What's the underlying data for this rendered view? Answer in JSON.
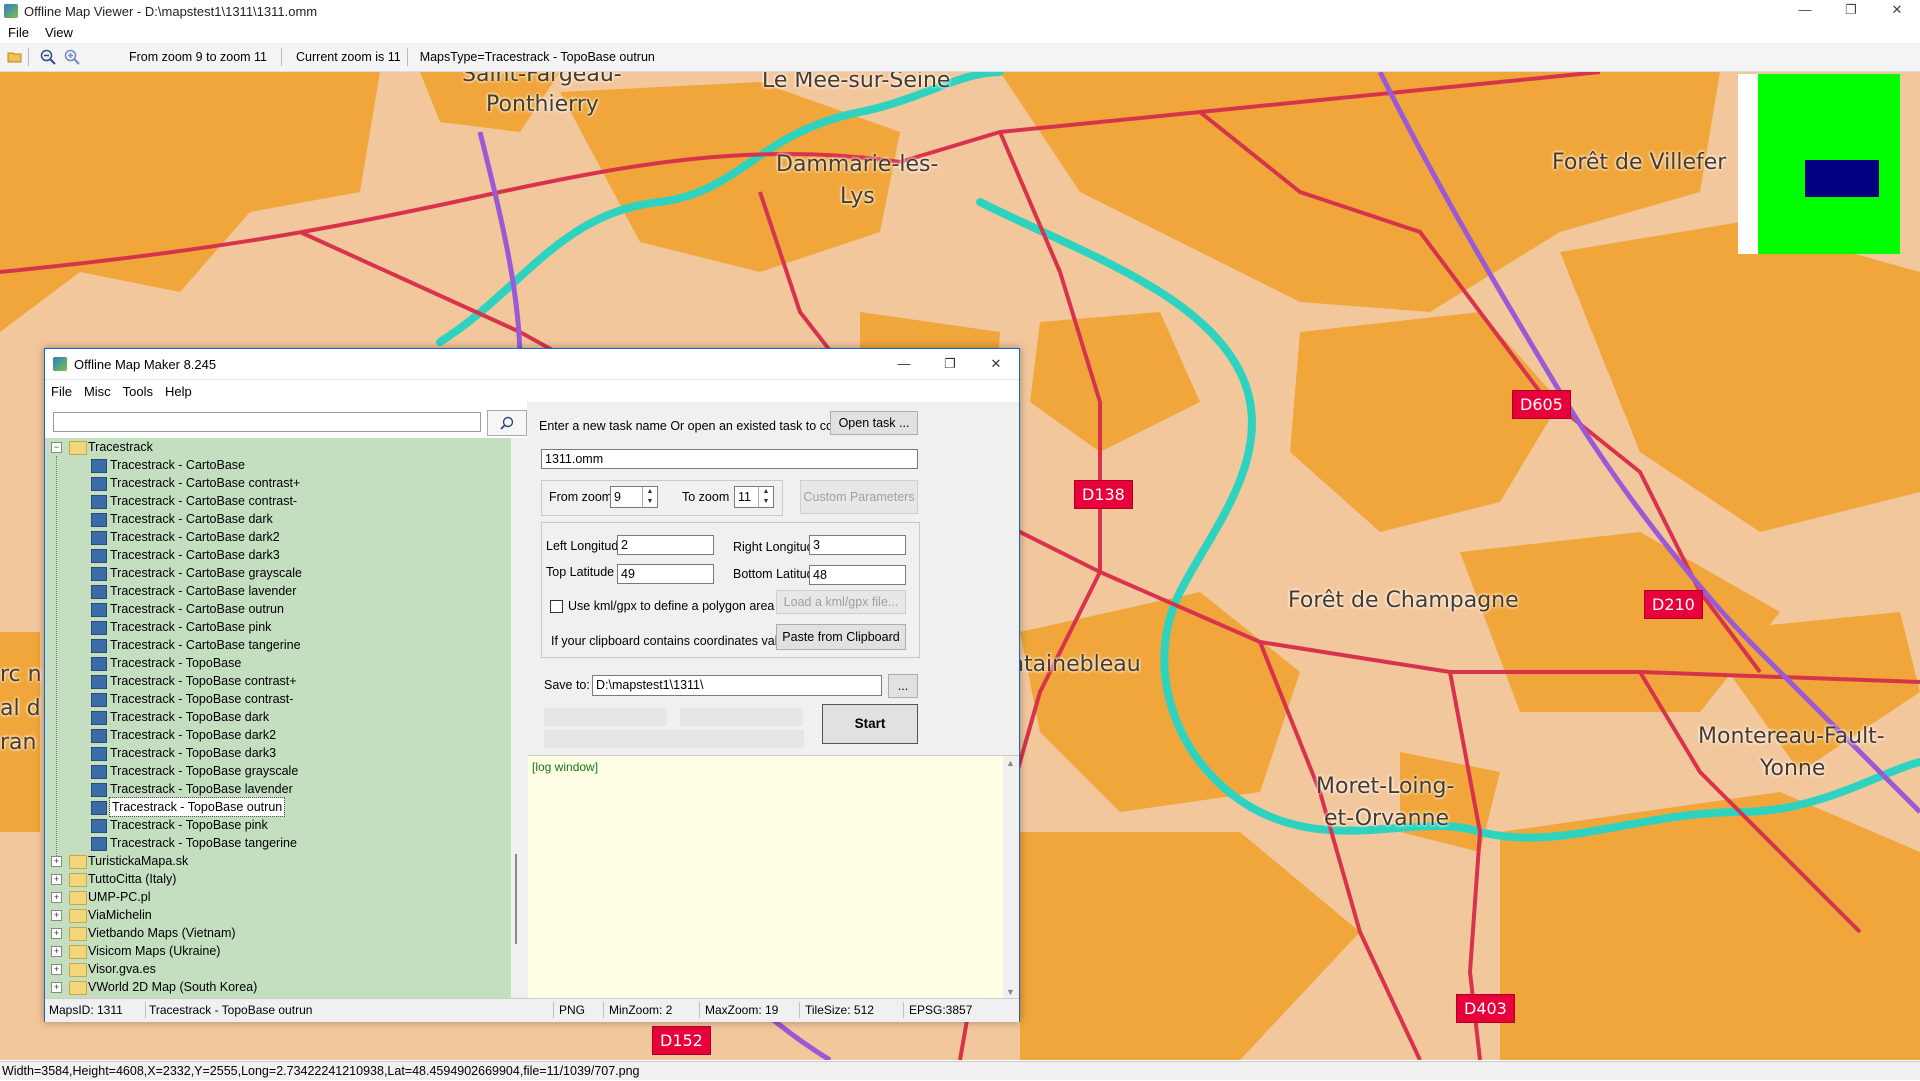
{
  "window": {
    "title": "Offline Map Viewer - D:\\mapstest1\\1311\\1311.omm",
    "controls": [
      "—",
      "❐",
      "✕"
    ]
  },
  "menu": [
    "File",
    "View"
  ],
  "toolbar": {
    "zoom_range": "From zoom 9 to zoom 11",
    "current_zoom": "Current zoom is 11",
    "maps_type": "MapsType=Tracestrack - TopoBase outrun"
  },
  "map": {
    "labels": [
      "Saint-Fargeau-",
      "Ponthierry",
      "Le Mee-sur-Seine",
      "Dammarie-les-",
      "Lys",
      "Forêt de Villefer",
      "Forêt de Champagne",
      "ntainebleau",
      "Moret-Loing-",
      "et-Orvanne",
      "Montereau-Fault-",
      "Yonne",
      "rc n",
      "al d",
      "ran"
    ],
    "road_badges": [
      "D605",
      "D138",
      "D210",
      "D403",
      "D152"
    ],
    "colors": {
      "land": "#f3c79c",
      "forest": "#f0a63a",
      "water": "#2ed3c0",
      "road_red": "#d8334d",
      "road_purple": "#9a5ad6"
    }
  },
  "minimap": {
    "bg": "#00ff00",
    "viewport": "#000080"
  },
  "bottom_status": "Width=3584,Height=4608,X=2332,Y=2555,Long=2.73422241210938,Lat=48.4594902669904,file=11/1039/707.png",
  "dialog": {
    "title": "Offline Map Maker 8.245",
    "menu": [
      "File",
      "Misc",
      "Tools",
      "Help"
    ],
    "search_placeholder": "",
    "tree": {
      "root": "Tracestrack",
      "children": [
        "Tracestrack - CartoBase",
        "Tracestrack - CartoBase contrast+",
        "Tracestrack - CartoBase contrast-",
        "Tracestrack - CartoBase dark",
        "Tracestrack - CartoBase dark2",
        "Tracestrack - CartoBase dark3",
        "Tracestrack - CartoBase grayscale",
        "Tracestrack - CartoBase lavender",
        "Tracestrack - CartoBase outrun",
        "Tracestrack - CartoBase pink",
        "Tracestrack - CartoBase tangerine",
        "Tracestrack - TopoBase",
        "Tracestrack - TopoBase contrast+",
        "Tracestrack - TopoBase contrast-",
        "Tracestrack - TopoBase dark",
        "Tracestrack - TopoBase dark2",
        "Tracestrack - TopoBase dark3",
        "Tracestrack - TopoBase grayscale",
        "Tracestrack - TopoBase lavender",
        "Tracestrack - TopoBase outrun",
        "Tracestrack - TopoBase pink",
        "Tracestrack - TopoBase tangerine"
      ],
      "selected": "Tracestrack - TopoBase outrun",
      "siblings": [
        "TuristickaMapa.sk",
        "TuttoCitta (Italy)",
        "UMP-PC.pl",
        "ViaMichelin",
        "Vietbando Maps (Vietnam)",
        "Visicom Maps (Ukraine)",
        "Visor.gva.es",
        "VWorld 2D Map (South Korea)"
      ]
    },
    "task_prompt": "Enter a new task name Or open an existed task to continue:",
    "open_task": "Open task ...",
    "task_name": "1311.omm",
    "from_zoom_label": "From zoom",
    "from_zoom": "9",
    "to_zoom_label": "To zoom",
    "to_zoom": "11",
    "custom_params": "Custom Parameters",
    "left_lon_label": "Left Longitude",
    "left_lon": "2",
    "right_lon_label": "Right Longitude",
    "right_lon": "3",
    "top_lat_label": "Top Latitude",
    "top_lat": "49",
    "bottom_lat_label": "Bottom Latitude",
    "bottom_lat": "48",
    "kml_label": "Use kml/gpx to define a polygon area",
    "load_kml": "Load a kml/gpx file...",
    "clipboard_label": "If your clipboard contains coordinates values:",
    "paste": "Paste from Clipboard",
    "save_to_label": "Save to:",
    "save_to": "D:\\mapstest1\\1311\\",
    "browse": "...",
    "start": "Start",
    "log": "[log window]",
    "status": {
      "maps_id": "MapsID: 1311",
      "map_name": "Tracestrack - TopoBase outrun",
      "format": "PNG",
      "min_zoom": "MinZoom: 2",
      "max_zoom": "MaxZoom: 19",
      "tile_size": "TileSize: 512",
      "epsg": "EPSG:3857"
    }
  }
}
